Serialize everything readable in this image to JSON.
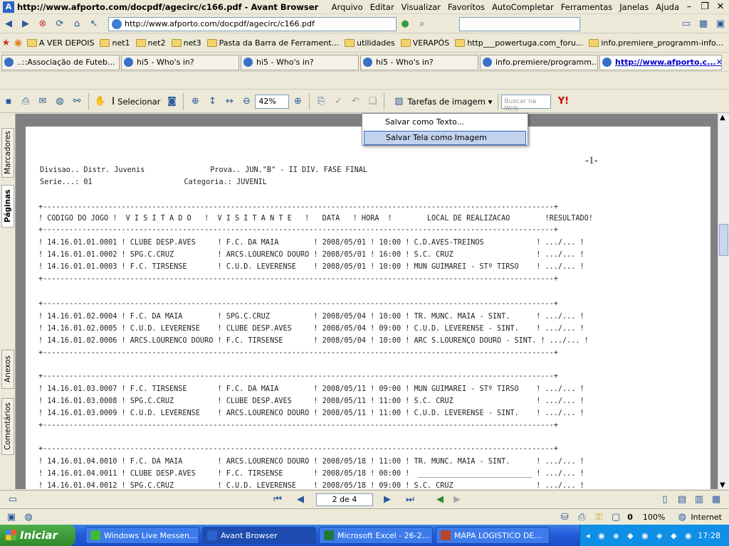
{
  "window": {
    "title": "http://www.afporto.com/docpdf/agecirc/c166.pdf - Avant Browser"
  },
  "menu": [
    "Arquivo",
    "Editar",
    "Visualizar",
    "Favoritos",
    "AutoCompletar",
    "Ferramentas",
    "Janelas",
    "Ajuda"
  ],
  "address": {
    "url": "http://www.afporto.com/docpdf/agecirc/c166.pdf"
  },
  "bookmarks": [
    "A VER DEPOIS",
    "net1",
    "net2",
    "net3",
    "Pasta da Barra de Ferrament...",
    "utilidades",
    "VERAPÓS",
    "http___powertuga.com_foru...",
    "info.premiere_programm-info..."
  ],
  "tabs": [
    "..::Associação de Futeb...",
    "hi5 - Who's in?",
    "hi5 - Who's in?",
    "hi5 - Who's in?",
    "info.premiere/programm...",
    "http://www.afporto.c..."
  ],
  "pdf_toolbar": {
    "select_label": "Selecionar",
    "zoom": "42%",
    "image_tasks_label": "Tarefas de imagem",
    "web_search_placeholder": "Buscar na Web"
  },
  "context_menu": {
    "items": [
      "Salvar como Texto...",
      "Salvar Tela como Imagem"
    ]
  },
  "left_panel": {
    "tabs": [
      "Marcadores",
      "Páginas",
      "Anexos",
      "Comentários"
    ]
  },
  "document": {
    "page_number_label": "-1-",
    "header_line1": "Divisao.. Distr. Juvenis               Prova.. JUN.\"B\" - II DIV. FASE FINAL",
    "header_line2": "Serie...: 01                     Categoria.: JUVENIL",
    "rule": "+---------------------------------------------------------------------------------------------------------------------+",
    "columns": "! CODIGO DO JOGO !  V I S I T A D O   !  V I S I T A N T E   !   DATA   ! HORA  !        LOCAL DE REALIZACAO        !RESULTADO!",
    "groups": [
      [
        "! 14.16.01.01.0001 ! CLUBE DESP.AVES     ! F.C. DA MAIA        ! 2008/05/01 ! 10:00 ! C.D.AVES-TREINOS            ! .../... !",
        "! 14.16.01.01.0002 ! SPG.C.CRUZ          ! ARCS.LOURENCO DOURO ! 2008/05/01 ! 16:00 ! S.C. CRUZ                   ! .../... !",
        "! 14.16.01.01.0003 ! F.C. TIRSENSE       ! C.U.D. LEVERENSE    ! 2008/05/01 ! 10:00 ! MUN GUIMAREI - STº TIRSO    ! .../... !"
      ],
      [
        "! 14.16.01.02.0004 ! F.C. DA MAIA        ! SPG.C.CRUZ          ! 2008/05/04 ! 10:00 ! TR. MUNC. MAIA - SINT.      ! .../... !",
        "! 14.16.01.02.0005 ! C.U.D. LEVERENSE    ! CLUBE DESP.AVES     ! 2008/05/04 ! 09:00 ! C.U.D. LEVERENSE - SINT.    ! .../... !",
        "! 14.16.01.02.0006 ! ARCS.LOURENCO DOURO ! F.C. TIRSENSE       ! 2008/05/04 ! 10:00 ! ARC S.LOURENÇO DOURO - SINT. ! .../... !"
      ],
      [
        "! 14.16.01.03.0007 ! F.C. TIRSENSE       ! F.C. DA MAIA        ! 2008/05/11 ! 09:00 ! MUN GUIMAREI - STº TIRSO    ! .../... !",
        "! 14.16.01.03.0008 ! SPG.C.CRUZ          ! CLUBE DESP.AVES     ! 2008/05/11 ! 11:00 ! S.C. CRUZ                   ! .../... !",
        "! 14.16.01.03.0009 ! C.U.D. LEVERENSE    ! ARCS.LOURENCO DOURO ! 2008/05/11 ! 11:00 ! C.U.D. LEVERENSE - SINT.    ! .../... !"
      ],
      [
        "! 14.16.01.04.0010 ! F.C. DA MAIA        ! ARCS.LOURENCO DOURO ! 2008/05/18 ! 11:00 ! TR. MUNC. MAIA - SINT.      ! .../... !",
        "! 14.16.01.04.0011 ! CLUBE DESP.AVES     ! F.C. TIRSENSE       ! 2008/05/18 ! 00:00 !  __________________________ ! .../... !",
        "! 14.16.01.04.0012 ! SPG.C.CRUZ          ! C.U.D. LEVERENSE    ! 2008/05/18 ! 09:00 ! S.C. CRUZ                   ! .../... !"
      ]
    ]
  },
  "pager": {
    "page": "2 de 4"
  },
  "status": {
    "count": "0",
    "zoom": "100%",
    "zone": "Internet"
  },
  "taskbar": {
    "start_label": "Iniciar",
    "tasks": [
      "Windows Live Messen...",
      "Avant Browser",
      "Microsoft Excel - 26-2...",
      "MAPA LOGISTICO DE..."
    ],
    "clock": "17:28"
  }
}
